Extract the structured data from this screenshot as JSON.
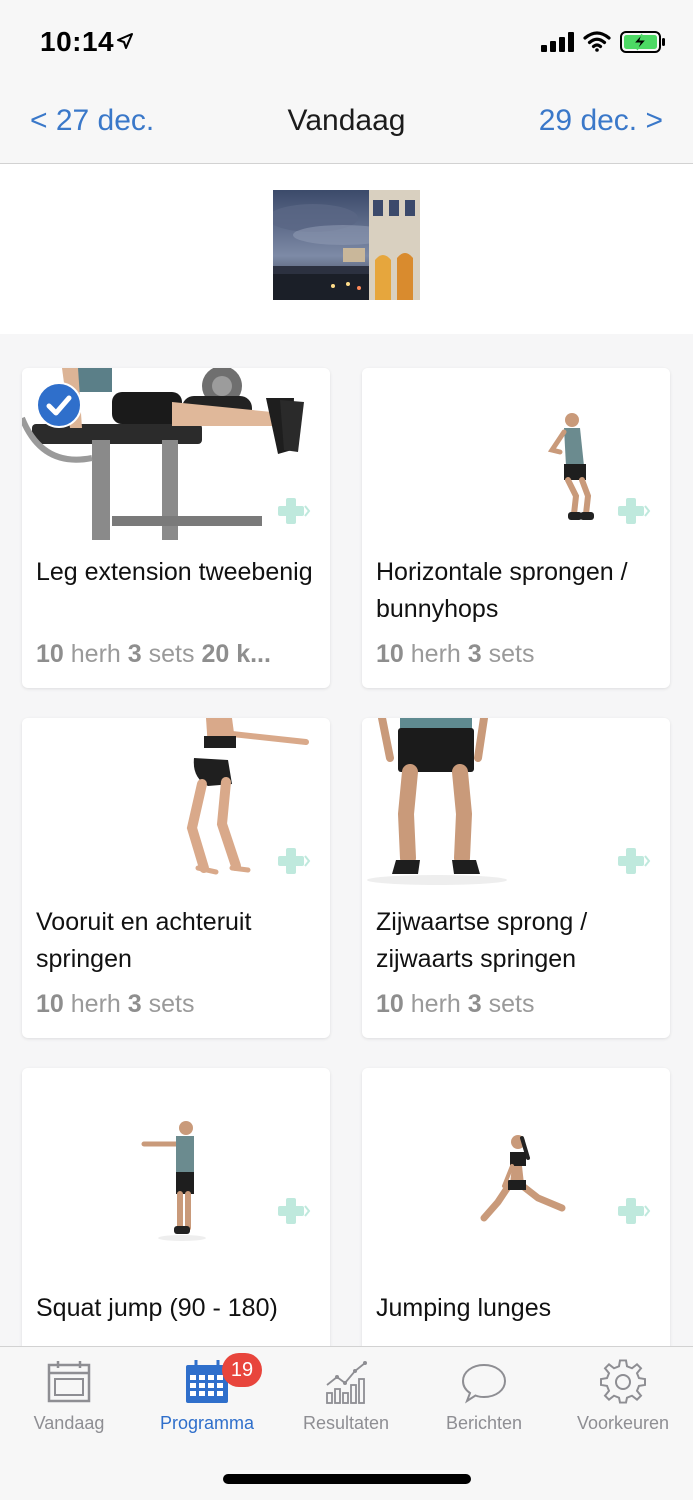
{
  "status_bar": {
    "time": "10:14",
    "location_icon": "location-arrow-icon",
    "signal_icon": "cellular-signal-icon",
    "wifi_icon": "wifi-icon",
    "battery_icon": "battery-charging-icon"
  },
  "nav": {
    "prev_label": "< 27 dec.",
    "title": "Vandaag",
    "next_label": "29 dec. >"
  },
  "header_photo": {
    "icon": "header-photo"
  },
  "colors": {
    "accent": "#3a78c9",
    "check_blue": "#2f6fcb",
    "badge_red": "#e8453c",
    "plus_mint": "#bfe9dd"
  },
  "exercises": [
    {
      "title": "Leg extension tweebenig",
      "meta": {
        "reps": "10",
        "reps_unit": "herh",
        "sets": "3",
        "sets_unit": "sets",
        "weight": "20 k..."
      },
      "completed": true,
      "icon": "leg-extension-machine-image"
    },
    {
      "title": "Horizontale sprongen / bunnyhops",
      "meta": {
        "reps": "10",
        "reps_unit": "herh",
        "sets": "3",
        "sets_unit": "sets"
      },
      "completed": false,
      "icon": "jumping-man-image"
    },
    {
      "title": "Vooruit en achteruit springen",
      "meta": {
        "reps": "10",
        "reps_unit": "herh",
        "sets": "3",
        "sets_unit": "sets"
      },
      "completed": false,
      "icon": "squatting-woman-image"
    },
    {
      "title": "Zijwaartse sprong / zijwaarts springen",
      "meta": {
        "reps": "10",
        "reps_unit": "herh",
        "sets": "3",
        "sets_unit": "sets"
      },
      "completed": false,
      "icon": "standing-legs-image"
    },
    {
      "title": "Squat jump (90 - 180)",
      "completed": false,
      "icon": "squat-jump-man-image"
    },
    {
      "title": "Jumping lunges",
      "completed": false,
      "icon": "lunging-woman-image"
    }
  ],
  "tabs": [
    {
      "label": "Vandaag",
      "icon": "calendar-today-icon",
      "active": false
    },
    {
      "label": "Programma",
      "icon": "calendar-grid-icon",
      "active": true,
      "badge": "19"
    },
    {
      "label": "Resultaten",
      "icon": "chart-icon",
      "active": false
    },
    {
      "label": "Berichten",
      "icon": "speech-bubble-icon",
      "active": false
    },
    {
      "label": "Voorkeuren",
      "icon": "gear-icon",
      "active": false
    }
  ]
}
